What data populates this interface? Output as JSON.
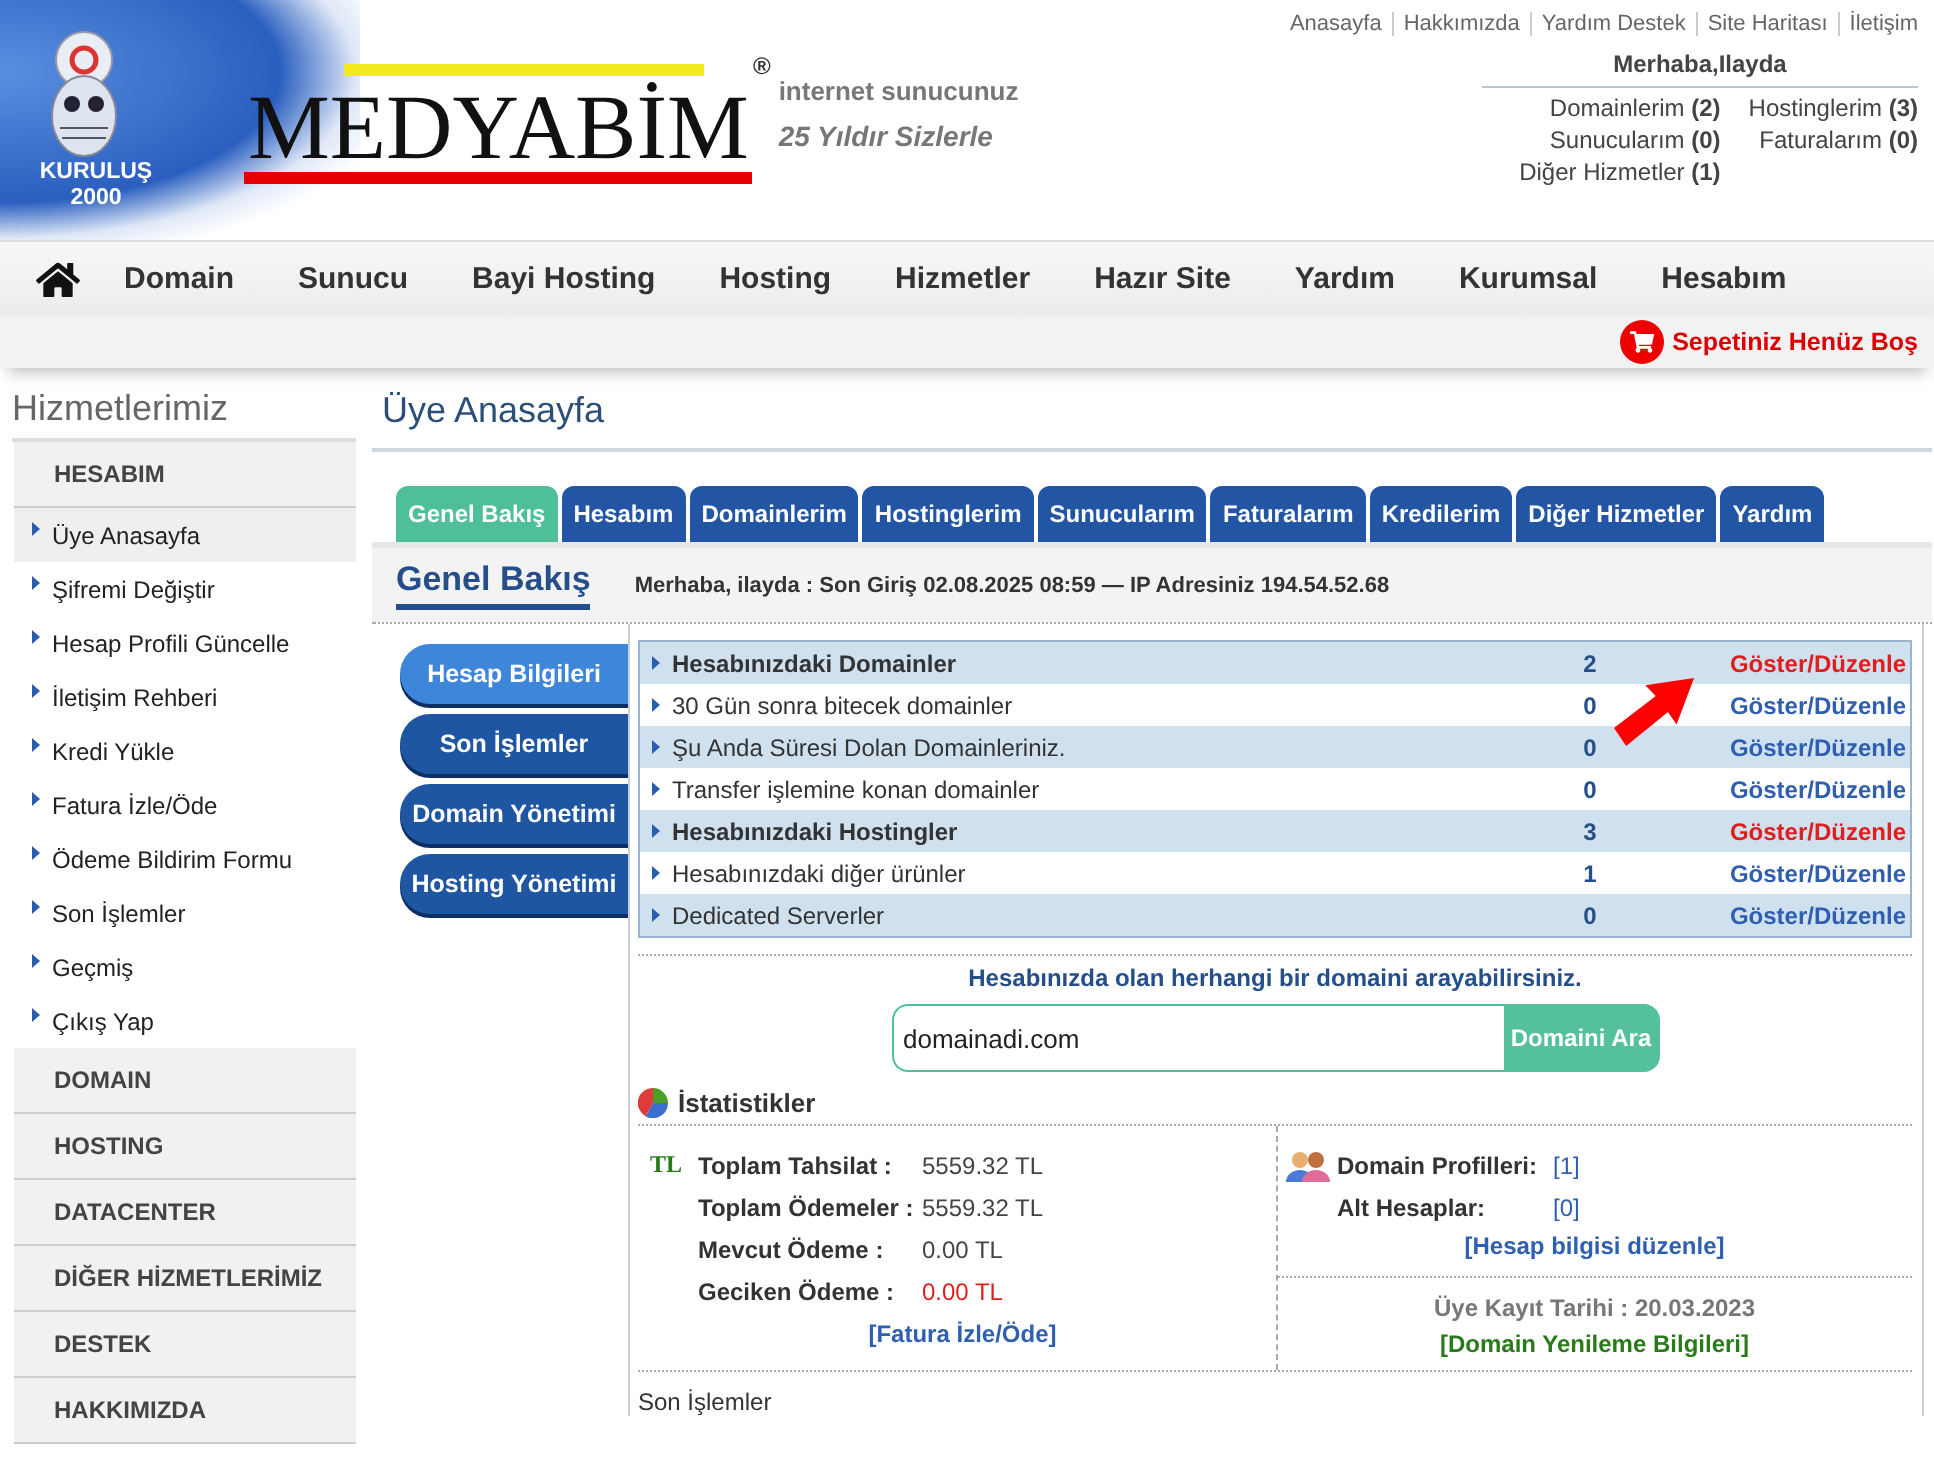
{
  "header": {
    "badge": {
      "line_1": "KURULUŞ",
      "line_2": "2000"
    },
    "logo": {
      "wordmark": "MEDYABİM",
      "registered": "®",
      "tagline_1": "internet sunucunuz",
      "tagline_2": "25 Yıldır Sizlerle"
    },
    "top_links": [
      "Anasayfa",
      "Hakkımızda",
      "Yardım Destek",
      "Site Haritası",
      "İletişim"
    ],
    "greeting": "Merhaba,Ilayda",
    "account_counts": [
      {
        "label": "Domainlerim",
        "count": "(2)"
      },
      {
        "label": "Hostinglerim",
        "count": "(3)"
      },
      {
        "label": "Sunucularım",
        "count": "(0)"
      },
      {
        "label": "Faturalarım",
        "count": "(0)"
      },
      {
        "label": "Diğer Hizmetler",
        "count": "(1)"
      }
    ]
  },
  "nav": {
    "items": [
      "Domain",
      "Sunucu",
      "Bayi Hosting",
      "Hosting",
      "Hizmetler",
      "Hazır Site",
      "Yardım",
      "Kurumsal",
      "Hesabım"
    ]
  },
  "cart": {
    "label": "Sepetiniz Henüz Boş"
  },
  "sidebar": {
    "title": "Hizmetlerimiz",
    "sections": [
      {
        "label": "HESABIM",
        "items": [
          {
            "label": "Üye Anasayfa",
            "selected": true
          },
          {
            "label": "Şifremi Değiştir",
            "selected": false
          },
          {
            "label": "Hesap Profili Güncelle",
            "selected": false
          },
          {
            "label": "İletişim Rehberi",
            "selected": false
          },
          {
            "label": "Kredi Yükle",
            "selected": false
          },
          {
            "label": "Fatura İzle/Öde",
            "selected": false
          },
          {
            "label": "Ödeme Bildirim Formu",
            "selected": false
          },
          {
            "label": "Son İşlemler",
            "selected": false
          },
          {
            "label": "Geçmiş",
            "selected": false
          },
          {
            "label": "Çıkış Yap",
            "selected": false
          }
        ]
      },
      {
        "label": "DOMAIN"
      },
      {
        "label": "HOSTING"
      },
      {
        "label": "DATACENTER"
      },
      {
        "label": "DİĞER HİZMETLERİMİZ"
      },
      {
        "label": "DESTEK"
      },
      {
        "label": "HAKKIMIZDA"
      }
    ]
  },
  "page_title": "Üye Anasayfa",
  "tabs": [
    {
      "label": "Genel Bakış",
      "selected": true
    },
    {
      "label": "Hesabım",
      "selected": false
    },
    {
      "label": "Domainlerim",
      "selected": false
    },
    {
      "label": "Hostinglerim",
      "selected": false
    },
    {
      "label": "Sunucularım",
      "selected": false
    },
    {
      "label": "Faturalarım",
      "selected": false
    },
    {
      "label": "Kredilerim",
      "selected": false
    },
    {
      "label": "Diğer Hizmetler",
      "selected": false
    },
    {
      "label": "Yardım",
      "selected": false
    }
  ],
  "panel": {
    "title": "Genel Bakış",
    "welcome": "Merhaba, ilayda : Son Giriş 02.08.2025 08:59 — IP Adresiniz 194.54.52.68",
    "side_buttons": [
      {
        "label": "Hesap Bilgileri",
        "selected": true
      },
      {
        "label": "Son İşlemler",
        "selected": false
      },
      {
        "label": "Domain Yönetimi",
        "selected": false
      },
      {
        "label": "Hosting Yönetimi",
        "selected": false
      }
    ],
    "summary_rows": [
      {
        "label": "Hesabınızdaki Domainler",
        "count": "2",
        "action": "Göster/Düzenle",
        "highlighted": true
      },
      {
        "label": "30 Gün sonra bitecek domainler",
        "count": "0",
        "action": "Göster/Düzenle",
        "highlighted": false
      },
      {
        "label": "Şu Anda Süresi Dolan Domainleriniz.",
        "count": "0",
        "action": "Göster/Düzenle",
        "highlighted": false
      },
      {
        "label": "Transfer işlemine konan domainler",
        "count": "0",
        "action": "Göster/Düzenle",
        "highlighted": false
      },
      {
        "label": "Hesabınızdaki Hostingler",
        "count": "3",
        "action": "Göster/Düzenle",
        "highlighted": true
      },
      {
        "label": "Hesabınızdaki diğer ürünler",
        "count": "1",
        "action": "Göster/Düzenle",
        "highlighted": false
      },
      {
        "label": "Dedicated Serverler",
        "count": "0",
        "action": "Göster/Düzenle",
        "highlighted": false
      }
    ],
    "search": {
      "prompt": "Hesabınızda olan herhangi bir domaini arayabilirsiniz.",
      "value": "domainadi.com",
      "button": "Domaini Ara"
    },
    "stats": {
      "title": "İstatistikler",
      "currency_mark": "TL",
      "payments": [
        {
          "label": "Toplam Tahsilat :",
          "value": "5559.32 TL",
          "overdue": false
        },
        {
          "label": "Toplam Ödemeler :",
          "value": "5559.32 TL",
          "overdue": false
        },
        {
          "label": "Mevcut Ödeme :",
          "value": "0.00 TL",
          "overdue": false
        },
        {
          "label": "Geciken Ödeme :",
          "value": "0.00 TL",
          "overdue": true
        }
      ],
      "invoice_link": "[Fatura İzle/Öde]",
      "profiles": [
        {
          "label": "Domain Profilleri:",
          "value": "[1]"
        },
        {
          "label": "Alt Hesaplar:",
          "value": "[0]"
        }
      ],
      "account_link": "[Hesap bilgisi düzenle]",
      "member_since": "Üye Kayıt Tarihi : 20.03.2023",
      "renewal_link": "[Domain Yenileme Bilgileri]"
    },
    "recent_title": "Son İşlemler"
  }
}
